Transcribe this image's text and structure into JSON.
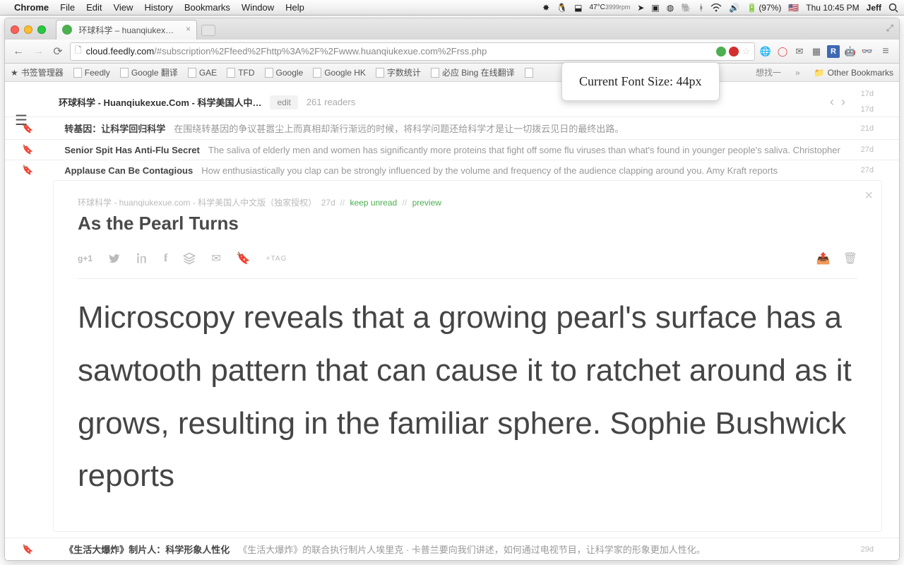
{
  "menubar": {
    "app": "Chrome",
    "items": [
      "File",
      "Edit",
      "View",
      "History",
      "Bookmarks",
      "Window",
      "Help"
    ],
    "temp": "47°C",
    "rpm": "3999rpm",
    "battery": "(97%)",
    "flag": "🇺🇸",
    "time": "Thu 10:45 PM",
    "user": "Jeff"
  },
  "tab": {
    "title": "环球科学 – huanqiukexue.c…"
  },
  "url": {
    "host": "cloud.feedly.com",
    "rest": "/#subscription%2Ffeed%2Fhttp%3A%2F%2Fwww.huanqiukexue.com%2Frss.php"
  },
  "bookmarks": [
    "书签管理器",
    "Feedly",
    "Google 翻译",
    "GAE",
    "TFD",
    "Google",
    "Google HK",
    "字数统计",
    "必应 Bing 在线翻译"
  ],
  "bookmark_hidden": "想找一",
  "other_bookmarks": "Other Bookmarks",
  "tooltip": "Current Font Size: 44px",
  "feed": {
    "title": "环球科学 - Huanqiukexue.Com - 科学美国人中…",
    "edit": "edit",
    "readers": "261 readers",
    "top_dates": [
      "17d",
      "17d"
    ]
  },
  "rows": [
    {
      "title": "转基因：让科学回归科学",
      "sum": "在围绕转基因的争议甚嚣尘上而真相却渐行渐远的时候，将科学问题还给科学才是让一切拨云见日的最终出路。",
      "age": "21d"
    },
    {
      "title": "Senior Spit Has Anti-Flu Secret",
      "sum": "The saliva of elderly men and women has significantly more proteins that fight off some flu viruses than what's found in younger people's saliva. Christopher",
      "age": "27d"
    },
    {
      "title": "Applause Can Be Contagious",
      "sum": "How enthusiastically you clap can be strongly influenced by the volume and frequency of the audience clapping around you. Amy Kraft reports",
      "age": "27d"
    }
  ],
  "article": {
    "source": "环球科学 - huanqiukexue.com - 科学美国人中文版（独家授权）",
    "age": "27d",
    "keep_unread": "keep unread",
    "preview": "preview",
    "title": "As the Pearl Turns",
    "tag_label": "+TAG",
    "body": "Microscopy reveals that a growing pearl's surface has a sawtooth pattern that can cause it to ratchet around as it grows, resulting in the familiar sphere. Sophie Bushwick reports"
  },
  "bottom_row": {
    "title": "《生活大爆炸》制片人：科学形象人性化",
    "sum": "《生活大爆炸》的联合执行制片人埃里克 · 卡普兰要向我们讲述，如何通过电视节目，让科学家的形象更加人性化。",
    "age": "29d"
  }
}
